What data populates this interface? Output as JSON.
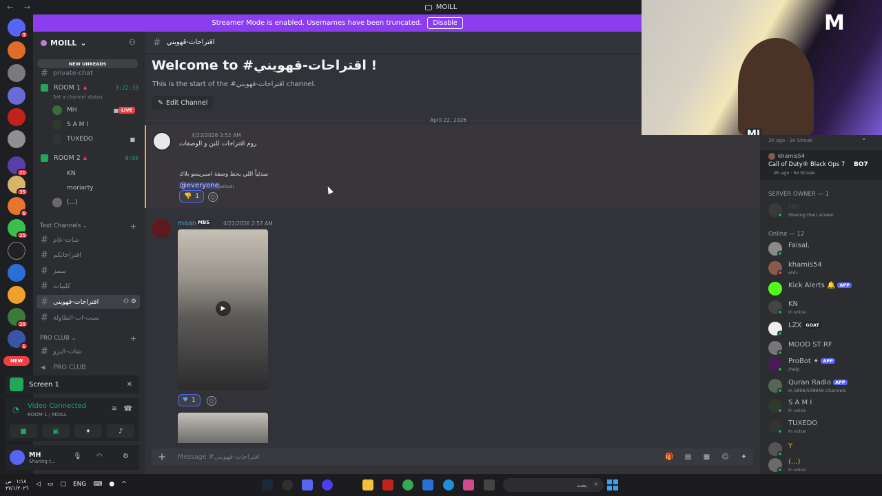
{
  "titlebar": {
    "title": "MOILL",
    "nav": "← →"
  },
  "banner": {
    "text": "Streamer Mode is enabled. Usernames have been truncated.",
    "button": "Disable"
  },
  "rail": {
    "badges": [
      "3",
      "21",
      "35",
      "6",
      "25",
      "1",
      "28",
      "1"
    ],
    "new_label": "NEW",
    "colors": [
      "#5865f2",
      "#e06c2b",
      "#7a7a7a",
      "#6b6bd6",
      "#c2221c",
      "#8f8f8f",
      "#5a3ea8",
      "#d7b46a",
      "#e8742e",
      "#3bbf4b",
      "#222222",
      "#2a6fd6",
      "#f0a12c",
      "#3b7a3b",
      "#3b54a8",
      "#c23b3b"
    ]
  },
  "sidebar": {
    "server_name": "MOILL",
    "new_unreads": "NEW UNREADS",
    "private_chat": "private-chat",
    "room1": {
      "name": "ROOM 1",
      "timer": "3:22:33",
      "status": "Set a channel status",
      "users": [
        "MH",
        "S A M I",
        "TUXEDO"
      ],
      "live": "LIVE"
    },
    "room2": {
      "name": "ROOM 2",
      "timer": "8:05",
      "users": [
        "KN",
        "moriarty",
        "(...)"
      ]
    },
    "text_channels_label": "Text Channels",
    "text_channels": [
      "شات-عام",
      "اقتراحاتكم",
      "ميمز",
      "كليبات",
      "اقتراحات-قهويني",
      "سيت-اب-الطاولة"
    ],
    "pro_club_label": "PRO CLUB",
    "pro_club_channels": [
      "شات-البرو",
      "PRO CLUB"
    ]
  },
  "panel": {
    "screen_label": "Screen 1",
    "video_connected": "Video Connected",
    "video_sub": "ROOM 1 / MOILL",
    "user_name": "MH",
    "user_status": "Sharing t..."
  },
  "main": {
    "channel_name": "اقتراحات-قهويني",
    "welcome_title": "Welcome to #اقتراحات-قهويني !",
    "welcome_sub": "This is the start of the #اقتراحات-قهويني channel.",
    "edit_channel": "Edit Channel",
    "date_divider": "April 22, 2026",
    "msg1": {
      "time": "4/22/2026 2:52 AM",
      "line1": "روم اقتراحات للبن و الوصفات",
      "line2": "مبدئياً اللي يحط وصفة اسبريسو بلاك",
      "mention": "@everyone",
      "edited": "(edited)",
      "reaction_count": "1"
    },
    "msg2": {
      "author": "maan",
      "tag": "MBS",
      "time": "4/22/2026 2:57 AM",
      "reaction_count": "1"
    },
    "composer_placeholder": "Message #اقتراحات-قهويني"
  },
  "members": {
    "top_line": "3h ago · 9x Streak",
    "activity": {
      "user": "khamis54",
      "game": "Call of Duty® Black Ops 7",
      "meta": "9h ago · 6x Streak"
    },
    "owner_header": "SERVER OWNER — 1",
    "owner": {
      "name": "MH",
      "sub": "Sharing their screen"
    },
    "online_header": "Online — 12",
    "list": [
      {
        "name": "Faisal.",
        "sub": ""
      },
      {
        "name": "khamis54",
        "sub": "ohh.."
      },
      {
        "name": "Kick Alerts",
        "sub": "",
        "badge": "APP"
      },
      {
        "name": "KN",
        "sub": "In voice"
      },
      {
        "name": "LZX",
        "sub": "",
        "badge2": "GOAT"
      },
      {
        "name": "MOOD ST RF",
        "sub": ""
      },
      {
        "name": "ProBot",
        "sub": "/help",
        "badge": "APP"
      },
      {
        "name": "Quran Radio",
        "sub": "in 5896/508949 Channels",
        "badge": "APP"
      },
      {
        "name": "S A M I",
        "sub": "In voice"
      },
      {
        "name": "TUXEDO",
        "sub": "In voice"
      },
      {
        "name": "Y",
        "sub": ""
      },
      {
        "name": "(...)",
        "sub": "In voice"
      }
    ]
  },
  "webcam": {
    "logo": "M",
    "tag": "MJ"
  },
  "taskbar": {
    "clock_time": "٠١:١٨ ص",
    "clock_date": "٢٧/١/٢٠٢٦",
    "lang": "ENG",
    "search_placeholder": "بحث"
  }
}
